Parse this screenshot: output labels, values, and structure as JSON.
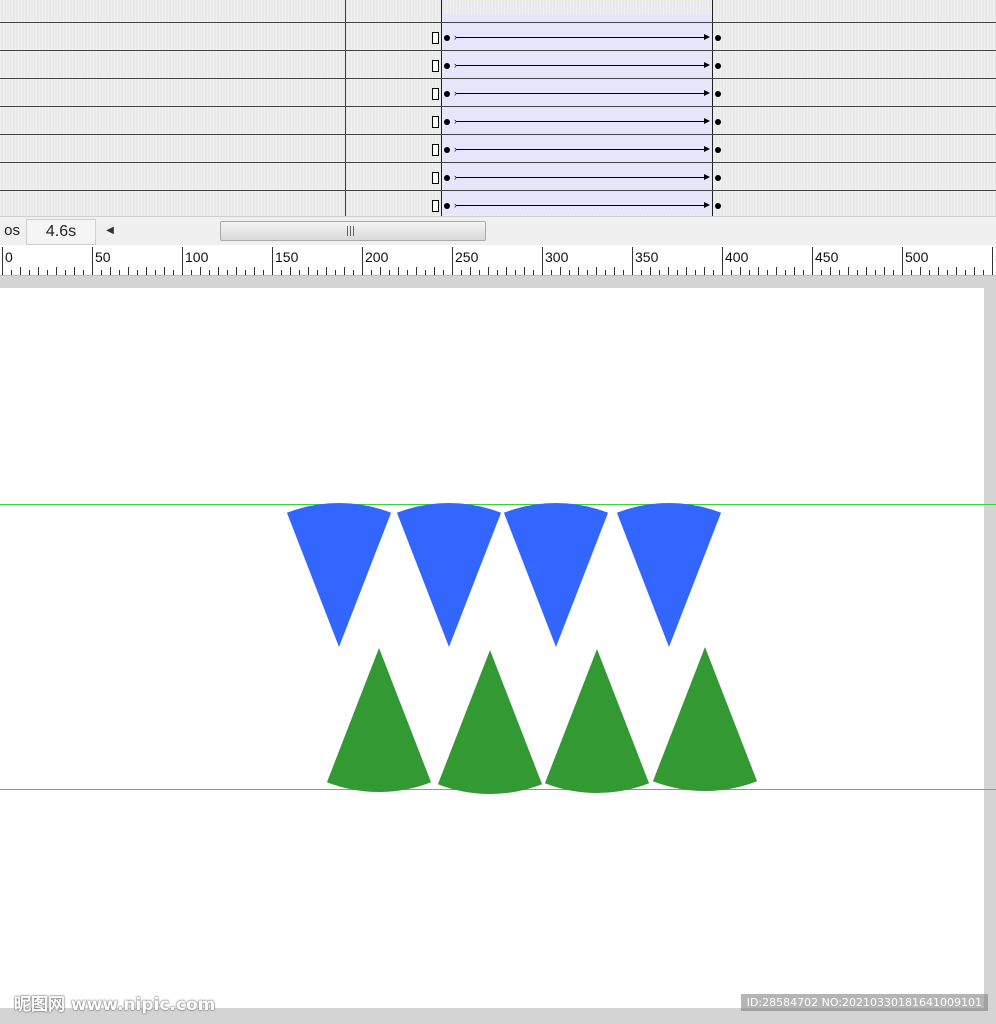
{
  "timeline": {
    "row_count": 7,
    "tween_start_frame_marker": "start-keyframe",
    "tween_end_frame_marker": "end-keyframe"
  },
  "status": {
    "fps_partial": "os",
    "current_time": "4.6s"
  },
  "ruler": {
    "labels": [
      "0",
      "50",
      "100",
      "150",
      "200",
      "250",
      "300",
      "350",
      "400",
      "450",
      "500",
      "5"
    ]
  },
  "stage": {
    "blue_color": "#3366ff",
    "green_color": "#339933",
    "guide_color": "#39d239",
    "blue_shape_count": 4,
    "green_shape_count": 4
  },
  "watermark": {
    "left": "昵图网 www.nipic.com",
    "right": "ID:28584702 NO:20210330181641009101"
  }
}
